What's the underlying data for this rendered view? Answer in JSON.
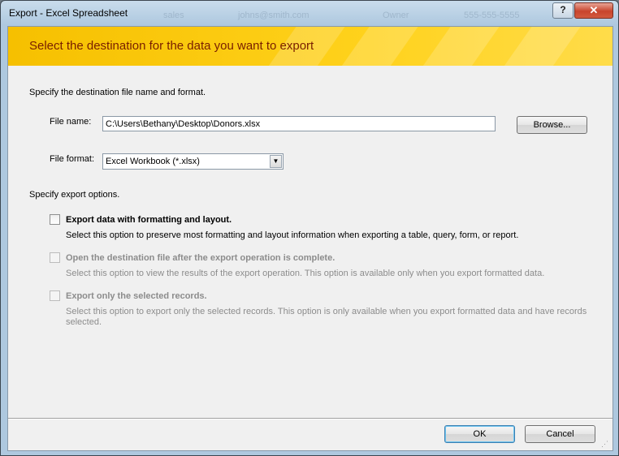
{
  "window": {
    "title": "Export - Excel Spreadsheet",
    "help_button": "?",
    "close_button": "✕",
    "background_ghost_text": [
      "sales",
      "johns@smith.com",
      "Owner",
      "555-555-5555"
    ]
  },
  "banner": {
    "text": "Select the destination for the data you want to export"
  },
  "destination": {
    "heading": "Specify the destination file name and format.",
    "file_name_label": "File name:",
    "file_name_value": "C:\\Users\\Bethany\\Desktop\\Donors.xlsx",
    "browse_label": "Browse...",
    "file_format_label": "File format:",
    "file_format_value": "Excel Workbook (*.xlsx)"
  },
  "options": {
    "heading": "Specify export options.",
    "items": [
      {
        "title": "Export data with formatting and layout.",
        "description": "Select this option to preserve most formatting and layout information when exporting a table, query, form, or report.",
        "checked": false,
        "enabled": true
      },
      {
        "title": "Open the destination file after the export operation is complete.",
        "description": "Select this option to view the results of the export operation. This option is available only when you export formatted data.",
        "checked": false,
        "enabled": false
      },
      {
        "title": "Export only the selected records.",
        "description": "Select this option to export only the selected records. This option is only available when you export formatted data and have records selected.",
        "checked": false,
        "enabled": false
      }
    ]
  },
  "footer": {
    "ok_label": "OK",
    "cancel_label": "Cancel"
  },
  "colors": {
    "banner": "#f6c000",
    "banner_text": "#7a2000",
    "disabled_text": "#8c8c8c"
  }
}
